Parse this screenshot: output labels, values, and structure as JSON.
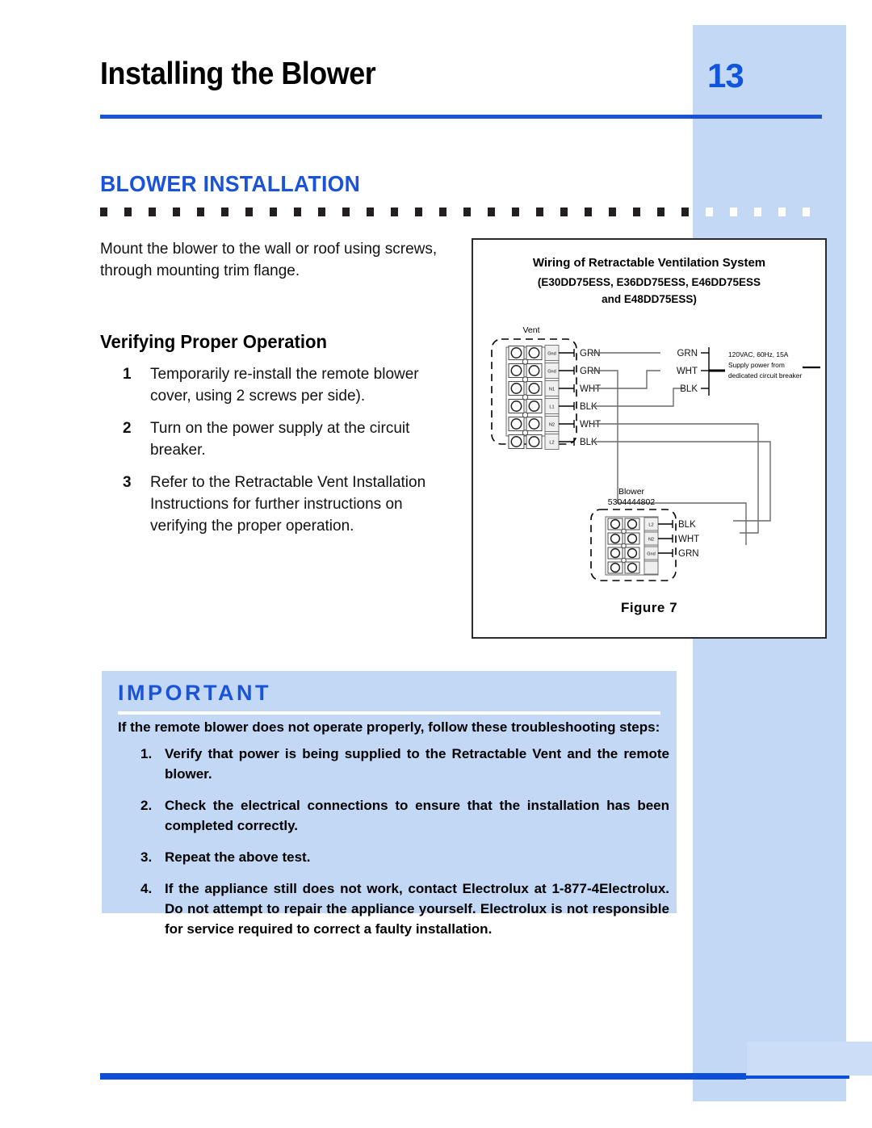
{
  "header": {
    "title": "Installing the Blower",
    "page_number": "13"
  },
  "section": {
    "heading": "BLOWER INSTALLATION"
  },
  "body": {
    "intro": "Mount the blower to the wall or roof using screws, through mounting trim flange.",
    "sub_heading": "Verifying Proper Operation",
    "steps": [
      {
        "num": "1",
        "text": "Temporarily re-install the remote blower cover, using 2 screws per side)."
      },
      {
        "num": "2",
        "text": "Turn on the power supply at the circuit breaker."
      },
      {
        "num": "3",
        "text": "Refer to the Retractable Vent Installation Instructions for further instructions on verifying the proper operation."
      }
    ]
  },
  "figure": {
    "title": "Wiring of Retractable Ventilation System",
    "subtitle": "(E30DD75ESS, E36DD75ESS, E46DD75ESS\nand E48DD75ESS)",
    "caption": "Figure  7",
    "vent": {
      "label": "Vent",
      "terminals": [
        "Gnd",
        "Gnd",
        "N1",
        "L1",
        "N2",
        "L2"
      ],
      "wires": [
        "GRN",
        "GRN",
        "WHT",
        "BLK",
        "WHT",
        "BLK"
      ]
    },
    "supply": {
      "wires": [
        "GRN",
        "WHT",
        "BLK"
      ],
      "note_line1": "120VAC, 60Hz, 15A",
      "note_line2": "Supply power from",
      "note_line3": "dedicated circuit breaker"
    },
    "blower": {
      "label": "Blower",
      "part_number": "5304444802",
      "terminals": [
        "L2",
        "N2",
        "Gnd",
        ""
      ],
      "wires": [
        "BLK",
        "WHT",
        "GRN"
      ]
    }
  },
  "important": {
    "title": "IMPORTANT",
    "lead": "If the remote blower does not operate properly, follow these troubleshooting steps:",
    "items": [
      {
        "num": "1.",
        "text": "Verify that power is being supplied to the Retractable Vent and the remote blower."
      },
      {
        "num": "2.",
        "text": "Check the electrical connections to ensure that the installation has been completed correctly."
      },
      {
        "num": "3.",
        "text": "Repeat the above test."
      },
      {
        "num": "4.",
        "text": "If the appliance still does not work, contact Electrolux at 1-877-4Electrolux. Do not attempt to repair the appliance yourself. Electrolux is not responsible for service required to correct a faulty installation."
      }
    ]
  },
  "colors": {
    "accent_blue": "#1a53d8",
    "light_blue": "#c3d8f5",
    "rule_blue": "#0d4fd8",
    "text_black": "#111111"
  }
}
